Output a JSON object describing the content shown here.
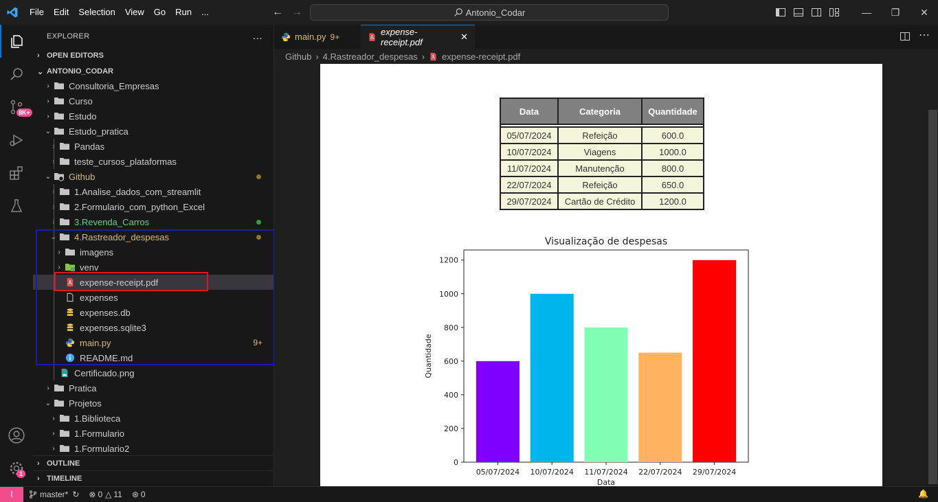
{
  "menu": [
    "File",
    "Edit",
    "Selection",
    "View",
    "Go",
    "Run",
    "..."
  ],
  "search": {
    "text": "Antonio_Codar"
  },
  "activity": {
    "scm_badge": "8K+",
    "accounts_badge": "1"
  },
  "explorer": {
    "title": "EXPLORER",
    "more": "...",
    "open_editors": "OPEN EDITORS",
    "root": "ANTONIO_CODAR",
    "outline": "OUTLINE",
    "timeline": "TIMELINE"
  },
  "tree": [
    {
      "label": "Consultoria_Empresas",
      "depth": 1,
      "kind": "folder",
      "open": false
    },
    {
      "label": "Curso",
      "depth": 1,
      "kind": "folder",
      "open": false
    },
    {
      "label": "Estudo",
      "depth": 1,
      "kind": "folder",
      "open": false
    },
    {
      "label": "Estudo_pratica",
      "depth": 1,
      "kind": "folder",
      "open": true
    },
    {
      "label": "Pandas",
      "depth": 2,
      "kind": "folder",
      "open": false
    },
    {
      "label": "teste_cursos_plataformas",
      "depth": 2,
      "kind": "folder",
      "open": false
    },
    {
      "label": "Github",
      "depth": 1,
      "kind": "folder-git",
      "open": true,
      "color": "#d7ba7d",
      "dot": "#8a7a2f"
    },
    {
      "label": "1.Analise_dados_com_streamlit",
      "depth": 2,
      "kind": "folder",
      "open": false
    },
    {
      "label": "2.Formulario_com_python_Excel",
      "depth": 2,
      "kind": "folder",
      "open": false
    },
    {
      "label": "3.Revenda_Carros",
      "depth": 2,
      "kind": "folder",
      "open": false,
      "color": "#73c991",
      "dot": "#2ea043"
    },
    {
      "label": "4.Rastreador_despesas",
      "depth": 2,
      "kind": "folder",
      "open": true,
      "color": "#d7ba7d",
      "dot": "#8a7a2f"
    },
    {
      "label": "imagens",
      "depth": 3,
      "kind": "folder",
      "open": false
    },
    {
      "label": "venv",
      "depth": 3,
      "kind": "folder-venv",
      "open": false
    },
    {
      "label": "expense-receipt.pdf",
      "depth": 3,
      "kind": "pdf",
      "selected": true
    },
    {
      "label": "expenses",
      "depth": 3,
      "kind": "file"
    },
    {
      "label": "expenses.db",
      "depth": 3,
      "kind": "db"
    },
    {
      "label": "expenses.sqlite3",
      "depth": 3,
      "kind": "db"
    },
    {
      "label": "main.py",
      "depth": 3,
      "kind": "python",
      "color": "#d7ba7d",
      "count": "9+"
    },
    {
      "label": "README.md",
      "depth": 3,
      "kind": "info"
    },
    {
      "label": "Certificado.png",
      "depth": 2,
      "kind": "image"
    },
    {
      "label": "Pratica",
      "depth": 1,
      "kind": "folder",
      "open": false
    },
    {
      "label": "Projetos",
      "depth": 1,
      "kind": "folder",
      "open": true
    },
    {
      "label": "1.Biblioteca",
      "depth": 2,
      "kind": "folder",
      "open": false
    },
    {
      "label": "1.Formulario",
      "depth": 2,
      "kind": "folder",
      "open": false
    },
    {
      "label": "1.Formulario2",
      "depth": 2,
      "kind": "folder",
      "open": false
    }
  ],
  "tabs": [
    {
      "label": "main.py",
      "extra": "9+",
      "active": false
    },
    {
      "label": "expense-receipt.pdf",
      "extra": "",
      "active": true
    }
  ],
  "breadcrumb": [
    "Github",
    "4.Rastreador_despesas",
    "expense-receipt.pdf"
  ],
  "receipt": {
    "headers": [
      "Data",
      "Categoria",
      "Quantidade"
    ],
    "rows": [
      [
        "05/07/2024",
        "Refeição",
        "600.0"
      ],
      [
        "10/07/2024",
        "Viagens",
        "1000.0"
      ],
      [
        "11/07/2024",
        "Manutenção",
        "800.0"
      ],
      [
        "22/07/2024",
        "Refeição",
        "650.0"
      ],
      [
        "29/07/2024",
        "Cartão de Crédito",
        "1200.0"
      ]
    ]
  },
  "chart_data": {
    "type": "bar",
    "title": "Visualização de despesas",
    "xlabel": "Data",
    "ylabel": "Quantidade",
    "categories": [
      "05/07/2024",
      "10/07/2024",
      "11/07/2024",
      "22/07/2024",
      "29/07/2024"
    ],
    "values": [
      600,
      1000,
      800,
      650,
      1200
    ],
    "colors": [
      "#8000ff",
      "#00b4ec",
      "#80ffb4",
      "#ffb360",
      "#ff0000"
    ],
    "ylim": [
      0,
      1260
    ],
    "yticks": [
      0,
      200,
      400,
      600,
      800,
      1000,
      1200
    ],
    "grid": false
  },
  "status": {
    "branch": "master*",
    "errors": "0",
    "warnings": "11",
    "ports": "0"
  }
}
